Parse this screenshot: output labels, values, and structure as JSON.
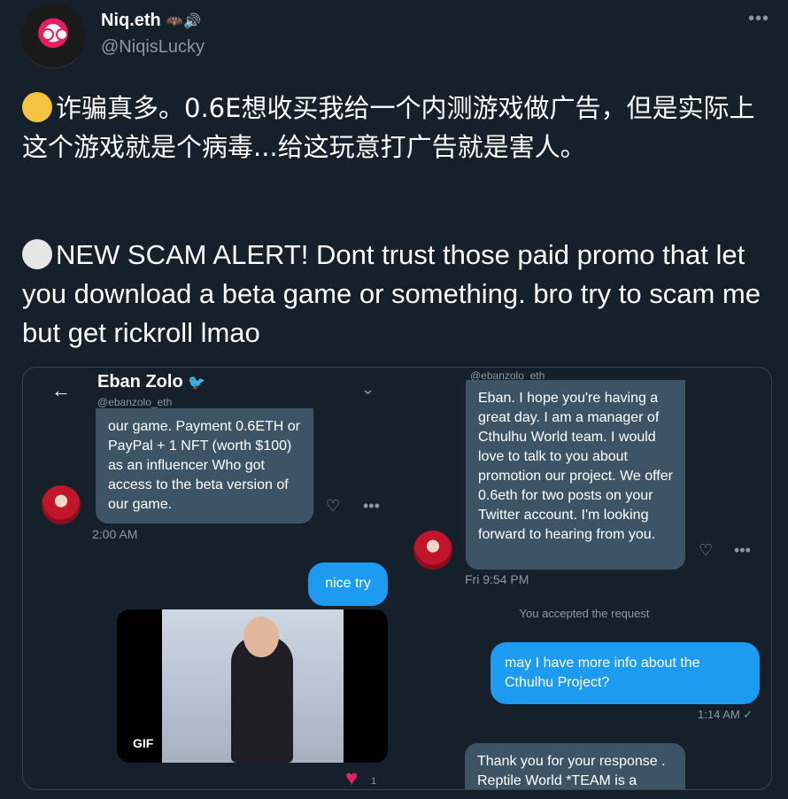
{
  "author": {
    "name": "Niq.eth",
    "name_suffix": "🦇🔊",
    "handle": "@NiqisLucky"
  },
  "tweet": {
    "text_cn": "诈骗真多。0.6E想收买我给一个内测游戏做广告，但是实际上这个游戏就是个病毒...给这玩意打广告就是害人。",
    "text_en": "NEW SCAM ALERT! Dont trust those paid promo that let you download a beta game or something. bro try to scam me but get rickroll lmao",
    "emoji_cn": "facepalm-emoji",
    "emoji_en": "skull-emoji"
  },
  "left_screenshot": {
    "contact_name": "Eban Zolo",
    "contact_handle": "@ebanzolo_eth",
    "message_1": "our game. Payment 0.6ETH or PayPal + 1 NFT (worth $100) as an influencer Who got access to the beta version of our game.",
    "message_1_time": "2:00 AM",
    "reply": "nice try",
    "gif_label": "GIF",
    "reaction_count": "1"
  },
  "right_screenshot": {
    "contact_handle": "@ebanzolo_eth",
    "message_1": "Eban. I hope you're having a great day. I am a manager of Cthulhu World team. I would love to talk to you about promotion our project. We offer 0.6eth for two posts on your Twitter account. I'm looking forward to hearing from you.",
    "message_1_time": "Fri 9:54 PM",
    "system_note": "You accepted the request",
    "reply": "may I have more info about the Cthulhu Project?",
    "reply_time": "1:14 AM ✓",
    "message_2": "Thank you for your response . Reptile World *TEAM is a"
  },
  "colors": {
    "background": "#15202b",
    "blue_bubble": "#1d9bf0",
    "gray_bubble": "#3d5466",
    "muted_text": "#8899a6"
  }
}
